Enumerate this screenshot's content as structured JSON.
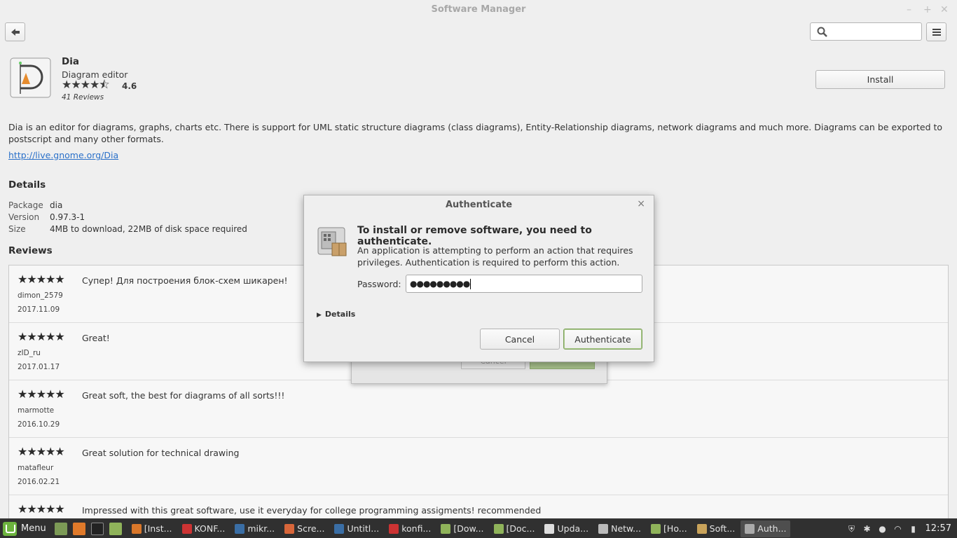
{
  "window": {
    "title": "Software Manager",
    "controls": [
      "–",
      "+",
      "✕"
    ]
  },
  "toolbar": {
    "back_icon": "arrow-left-icon",
    "search_placeholder": "",
    "menu_icon": "hamburger-menu-icon"
  },
  "app": {
    "name": "Dia",
    "summary": "Diagram editor",
    "stars": "★★★★⯪",
    "rating": "4.6",
    "reviews_count": "41 Reviews",
    "install_label": "Install",
    "description": "Dia is an editor for diagrams, graphs, charts etc. There is support for UML static structure diagrams (class diagrams), Entity-Relationship diagrams, network diagrams and much more. Diagrams can be exported to postscript and many other formats.",
    "link": "http://live.gnome.org/Dia"
  },
  "details": {
    "heading": "Details",
    "rows": [
      {
        "label": "Package",
        "value": "dia"
      },
      {
        "label": "Version",
        "value": "0.97.3-1"
      },
      {
        "label": "Size",
        "value": "4MB to download, 22MB of disk space required"
      }
    ]
  },
  "reviews": {
    "heading": "Reviews",
    "items": [
      {
        "stars": "★★★★★",
        "text": "Супер! Для построения блок-схем шикарен!",
        "user": "dimon_2579",
        "date": "2017.11.09"
      },
      {
        "stars": "★★★★★",
        "text": "Great!",
        "user": "zID_ru",
        "date": "2017.01.17"
      },
      {
        "stars": "★★★★★",
        "text": "Great soft, the best for diagrams of all sorts!!!",
        "user": "marmotte",
        "date": "2016.10.29"
      },
      {
        "stars": "★★★★★",
        "text": "Great solution for technical drawing",
        "user": "matafleur",
        "date": "2016.02.21"
      },
      {
        "stars": "★★★★★",
        "text": "Impressed with this great software, use it everyday for college programming assigments! recommended",
        "user": "",
        "date": ""
      }
    ]
  },
  "behind_dialog": {
    "cancel_label": "Cancel"
  },
  "auth_dialog": {
    "title": "Authenticate",
    "close": "×",
    "heading": "To install or remove software, you need to authenticate.",
    "message": "An application is attempting to perform an action that requires privileges. Authentication is required to perform this action.",
    "password_label": "Password:",
    "password_value": "●●●●●●●●●",
    "details_label": "Details",
    "cancel_label": "Cancel",
    "authenticate_label": "Authenticate"
  },
  "taskbar": {
    "menu_label": "Menu",
    "tasks": [
      {
        "label": "[Inst...",
        "color": "#d9772a"
      },
      {
        "label": "KONF...",
        "color": "#c33"
      },
      {
        "label": "mikr...",
        "color": "#3a6ea5"
      },
      {
        "label": "Scre...",
        "color": "#d8663a"
      },
      {
        "label": "Untitl...",
        "color": "#3a6ea5"
      },
      {
        "label": "konfi...",
        "color": "#c33"
      },
      {
        "label": "[Dow...",
        "color": "#8fb35a"
      },
      {
        "label": "[Doc...",
        "color": "#8fb35a"
      },
      {
        "label": "Upda...",
        "color": "#ddd"
      },
      {
        "label": "Netw...",
        "color": "#bbb"
      },
      {
        "label": "[Ho...",
        "color": "#8fb35a"
      },
      {
        "label": "Soft...",
        "color": "#c9a35a"
      },
      {
        "label": "Auth...",
        "color": "#aaa"
      }
    ],
    "clock": "12:57"
  }
}
